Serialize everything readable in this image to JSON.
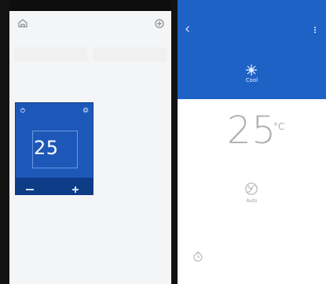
{
  "left": {
    "status": {
      "time": "",
      "right": ""
    },
    "title": "",
    "scenes_label": "",
    "scene_buttons": [
      "",
      ""
    ],
    "devices_label": "",
    "subgroup": "",
    "device": {
      "temperature": "25"
    }
  },
  "right": {
    "status": {
      "time": "",
      "right": ""
    },
    "title": "",
    "mode_label": "Cool",
    "temperature": "25",
    "unit": "°C",
    "fan_label": "Auto",
    "timer_label": ""
  },
  "colors": {
    "accent": "#1e62c6",
    "card": "#1d58b9"
  }
}
